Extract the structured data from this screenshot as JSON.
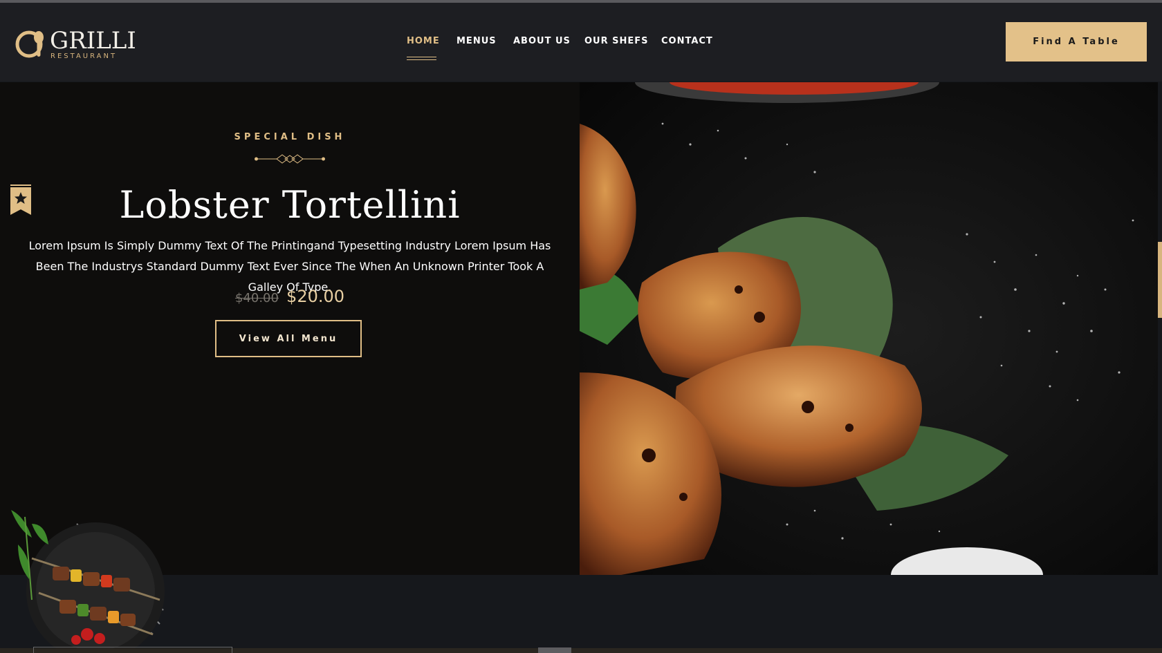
{
  "brand": {
    "name": "GRILLI",
    "tagline": "RESTAURANT",
    "accent_color": "#e0be86"
  },
  "nav": {
    "items": [
      {
        "label": "HOME",
        "active": true
      },
      {
        "label": "MENUS",
        "active": false
      },
      {
        "label": "ABOUT US",
        "active": false
      },
      {
        "label": "OUR SHEFS",
        "active": false
      },
      {
        "label": "CONTACT",
        "active": false
      }
    ]
  },
  "header": {
    "cta_label": "Find A Table"
  },
  "hero": {
    "subtitle": "SPECIAL DISH",
    "title": "Lobster Tortellini",
    "description": "Lorem Ipsum Is Simply Dummy Text Of The Printingand Typesetting Industry Lorem Ipsum Has Been The Industrys Standard Dummy Text Ever Since The When An Unknown Printer Took A Galley Of Type.",
    "old_price": "$40.00",
    "new_price": "$20.00",
    "button_label": "View All Menu",
    "badge_icon": "bookmark-star-icon",
    "image": "grilled-chicken-wings-photo"
  },
  "decor": {
    "plate_image": "grilled-kebab-plate"
  }
}
